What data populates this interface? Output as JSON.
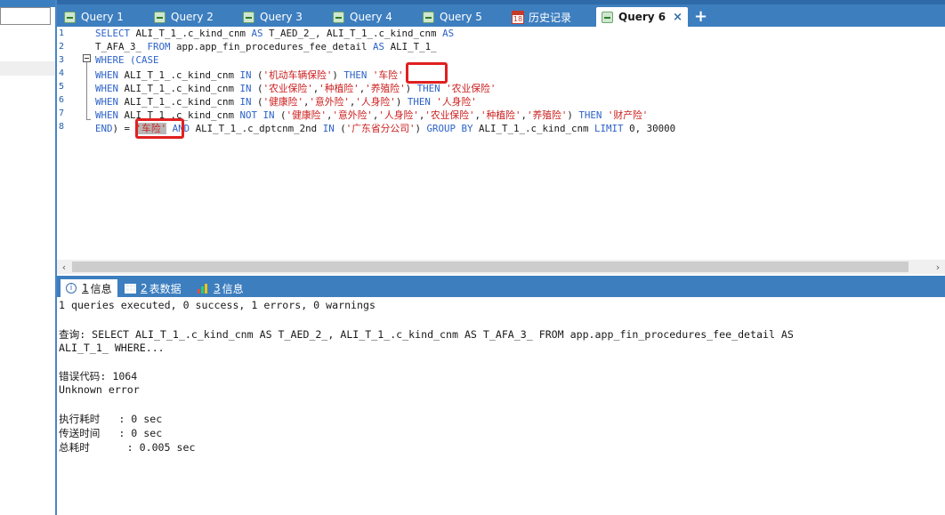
{
  "tabs": [
    {
      "label": "Query 1",
      "icon": "query-table-icon"
    },
    {
      "label": "Query 2",
      "icon": "query-table-icon"
    },
    {
      "label": "Query 3",
      "icon": "query-table-icon"
    },
    {
      "label": "Query 4",
      "icon": "query-table-icon"
    },
    {
      "label": "Query 5",
      "icon": "query-table-icon"
    },
    {
      "label": "历史记录",
      "icon": "calendar-icon",
      "icon_text": "18"
    },
    {
      "label": "Query 6",
      "icon": "query-table-icon",
      "active": true,
      "close": "×"
    }
  ],
  "new_tab": "+",
  "editor": {
    "line_numbers": [
      "1",
      "2",
      "3",
      "4",
      "5",
      "6",
      "7",
      "8"
    ],
    "lines": [
      {
        "segs": [
          {
            "t": "SELECT ",
            "c": "kw"
          },
          {
            "t": "ALI_T_1_.c_kind_cnm "
          },
          {
            "t": "AS ",
            "c": "kw"
          },
          {
            "t": "T_AED_2_, ALI_T_1_.c_kind_cnm "
          },
          {
            "t": "AS",
            "c": "kw"
          }
        ]
      },
      {
        "segs": [
          {
            "t": "T_AFA_3_ "
          },
          {
            "t": "FROM ",
            "c": "kw"
          },
          {
            "t": "app.app_fin_procedures_fee_detail "
          },
          {
            "t": "AS ",
            "c": "kw"
          },
          {
            "t": "ALI_T_1_"
          }
        ]
      },
      {
        "segs": [
          {
            "t": "WHERE (CASE",
            "c": "kw"
          }
        ]
      },
      {
        "segs": [
          {
            "t": "WHEN ",
            "c": "kw"
          },
          {
            "t": "ALI_T_1_.c_kind_cnm "
          },
          {
            "t": "IN ",
            "c": "kw"
          },
          {
            "t": "("
          },
          {
            "t": "'机动车辆保险'",
            "c": "str"
          },
          {
            "t": ") "
          },
          {
            "t": "THEN ",
            "c": "kw"
          },
          {
            "t": "'车险'",
            "c": "str"
          }
        ]
      },
      {
        "segs": [
          {
            "t": "WHEN ",
            "c": "kw"
          },
          {
            "t": "ALI_T_1_.c_kind_cnm "
          },
          {
            "t": "IN ",
            "c": "kw"
          },
          {
            "t": "("
          },
          {
            "t": "'农业保险'",
            "c": "str"
          },
          {
            "t": ","
          },
          {
            "t": "'种植险'",
            "c": "str"
          },
          {
            "t": ","
          },
          {
            "t": "'养殖险'",
            "c": "str"
          },
          {
            "t": ") "
          },
          {
            "t": "THEN ",
            "c": "kw"
          },
          {
            "t": "'农业保险'",
            "c": "str"
          }
        ]
      },
      {
        "segs": [
          {
            "t": "WHEN ",
            "c": "kw"
          },
          {
            "t": "ALI_T_1_.c_kind_cnm "
          },
          {
            "t": "IN ",
            "c": "kw"
          },
          {
            "t": "("
          },
          {
            "t": "'健康险'",
            "c": "str"
          },
          {
            "t": ","
          },
          {
            "t": "'意外险'",
            "c": "str"
          },
          {
            "t": ","
          },
          {
            "t": "'人身险'",
            "c": "str"
          },
          {
            "t": ") "
          },
          {
            "t": "THEN ",
            "c": "kw"
          },
          {
            "t": "'人身险'",
            "c": "str"
          }
        ]
      },
      {
        "segs": [
          {
            "t": "WHEN ",
            "c": "kw"
          },
          {
            "t": "ALI_T_1_.c_kind_cnm "
          },
          {
            "t": "NOT IN ",
            "c": "kw"
          },
          {
            "t": "("
          },
          {
            "t": "'健康险'",
            "c": "str"
          },
          {
            "t": ","
          },
          {
            "t": "'意外险'",
            "c": "str"
          },
          {
            "t": ","
          },
          {
            "t": "'人身险'",
            "c": "str"
          },
          {
            "t": ","
          },
          {
            "t": "'农业保险'",
            "c": "str"
          },
          {
            "t": ","
          },
          {
            "t": "'种植险'",
            "c": "str"
          },
          {
            "t": ","
          },
          {
            "t": "'养殖险'",
            "c": "str"
          },
          {
            "t": ") "
          },
          {
            "t": "THEN ",
            "c": "kw"
          },
          {
            "t": "'财产险'",
            "c": "str"
          }
        ]
      },
      {
        "segs": [
          {
            "t": "END",
            "c": "kw"
          },
          {
            "t": ") = "
          },
          {
            "t": "'车险'",
            "c": "str",
            "sel": true
          },
          {
            "t": " "
          },
          {
            "t": "AND ",
            "c": "kw"
          },
          {
            "t": "ALI_T_1_.c_dptcnm_2nd "
          },
          {
            "t": "IN ",
            "c": "kw"
          },
          {
            "t": "("
          },
          {
            "t": "'广东省分公司'",
            "c": "str"
          },
          {
            "t": ") "
          },
          {
            "t": "GROUP BY ",
            "c": "kw"
          },
          {
            "t": "ALI_T_1_.c_kind_cnm "
          },
          {
            "t": "LIMIT ",
            "c": "kw"
          },
          {
            "t": "0, 30000"
          }
        ]
      }
    ]
  },
  "bottom_tabs": [
    {
      "num": "1",
      "label": "信息",
      "icon": "info-icon",
      "active": true
    },
    {
      "num": "2",
      "label": "表数据",
      "icon": "table-grid-icon"
    },
    {
      "num": "3",
      "label": "信息",
      "icon": "bar-chart-icon"
    }
  ],
  "output": {
    "summary": "1 queries executed, 0 success, 1 errors, 0 warnings",
    "query_line1": "查询: SELECT ALI_T_1_.c_kind_cnm AS T_AED_2_, ALI_T_1_.c_kind_cnm AS T_AFA_3_ FROM app.app_fin_procedures_fee_detail AS",
    "query_line2": "ALI_T_1_ WHERE...",
    "error_code_line": "错误代码: 1064",
    "error_msg": "Unknown error",
    "exec_time": "执行耗时   : 0 sec",
    "transfer_time": "传送时间   : 0 sec",
    "total_time": "总耗时      : 0.005 sec"
  },
  "colors": {
    "tabbar": "#3d7ebf",
    "keyword": "#2c62c8",
    "string": "#cc1f1f",
    "highlight_box": "#e02020"
  }
}
